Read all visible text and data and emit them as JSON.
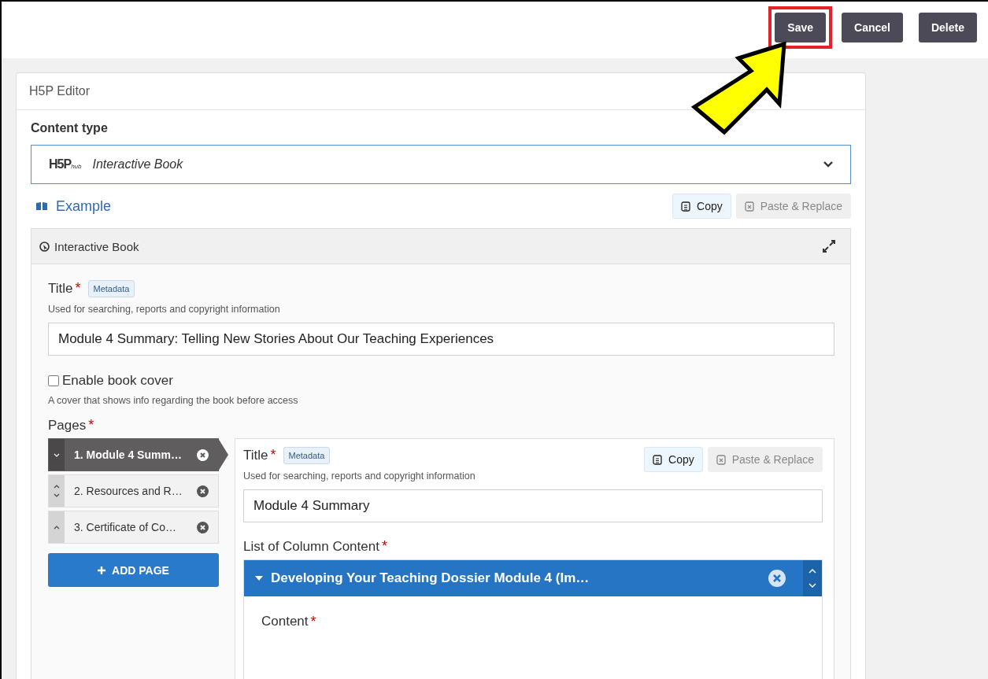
{
  "top_buttons": [
    {
      "label": "Save",
      "highlighted": true
    },
    {
      "label": "Cancel",
      "highlighted": false
    },
    {
      "label": "Delete",
      "highlighted": false
    }
  ],
  "editor": {
    "title": "H5P Editor",
    "content_type": {
      "label": "Content type",
      "logo": "H5P",
      "logo_sub": "hub",
      "value": "Interactive Book",
      "expanded": false
    },
    "example_link": "Example",
    "actions": [
      {
        "label": "Copy",
        "disabled": false
      },
      {
        "label": "Paste & Replace",
        "disabled": true
      }
    ],
    "group": {
      "title": "Interactive Book",
      "expanded": true,
      "title_field": {
        "label": "Title",
        "required_mark": "*",
        "metadata": "Metadata",
        "description": "Used for searching, reports and copyright information",
        "value": "Module 4 Summary: Telling New Stories About Our Teaching Experiences"
      },
      "book_cover": {
        "label": "Enable book cover",
        "checked": false,
        "description": "A cover that shows info regarding the book before access"
      },
      "pages": {
        "label": "Pages",
        "required_mark": "*",
        "add_label": "ADD PAGE",
        "items": [
          {
            "label": "1. Module 4 Summ…",
            "selected": true,
            "can_move_up": false,
            "can_move_down": true
          },
          {
            "label": "2. Resources and R…",
            "selected": false,
            "can_move_up": true,
            "can_move_down": true
          },
          {
            "label": "3. Certificate of Co…",
            "selected": false,
            "can_move_up": true,
            "can_move_down": false
          }
        ],
        "page_editor": {
          "title_label": "Title",
          "required_mark": "*",
          "metadata": "Metadata",
          "description": "Used for searching, reports and copyright information",
          "value": "Module 4 Summary",
          "actions": [
            {
              "label": "Copy",
              "disabled": false
            },
            {
              "label": "Paste & Replace",
              "disabled": true
            }
          ],
          "list_label": "List of Column Content",
          "list_required_mark": "*",
          "list_items": [
            {
              "title": "Developing Your Teaching Dossier Module 4 (Im…",
              "expanded": true,
              "content_label": "Content",
              "content_required_mark": "*"
            }
          ]
        }
      }
    }
  }
}
